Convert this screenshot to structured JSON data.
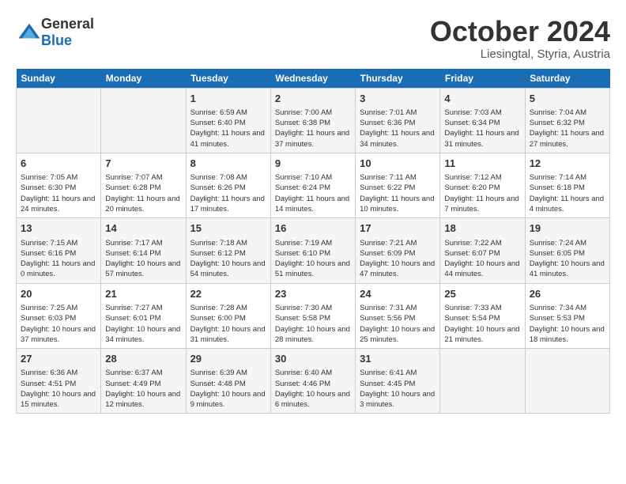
{
  "header": {
    "logo": {
      "general": "General",
      "blue": "Blue"
    },
    "title": "October 2024",
    "subtitle": "Liesingtal, Styria, Austria"
  },
  "weekdays": [
    "Sunday",
    "Monday",
    "Tuesday",
    "Wednesday",
    "Thursday",
    "Friday",
    "Saturday"
  ],
  "weeks": [
    [
      {
        "day": null,
        "info": null
      },
      {
        "day": null,
        "info": null
      },
      {
        "day": "1",
        "info": "Sunrise: 6:59 AM\nSunset: 6:40 PM\nDaylight: 11 hours and 41 minutes."
      },
      {
        "day": "2",
        "info": "Sunrise: 7:00 AM\nSunset: 6:38 PM\nDaylight: 11 hours and 37 minutes."
      },
      {
        "day": "3",
        "info": "Sunrise: 7:01 AM\nSunset: 6:36 PM\nDaylight: 11 hours and 34 minutes."
      },
      {
        "day": "4",
        "info": "Sunrise: 7:03 AM\nSunset: 6:34 PM\nDaylight: 11 hours and 31 minutes."
      },
      {
        "day": "5",
        "info": "Sunrise: 7:04 AM\nSunset: 6:32 PM\nDaylight: 11 hours and 27 minutes."
      }
    ],
    [
      {
        "day": "6",
        "info": "Sunrise: 7:05 AM\nSunset: 6:30 PM\nDaylight: 11 hours and 24 minutes."
      },
      {
        "day": "7",
        "info": "Sunrise: 7:07 AM\nSunset: 6:28 PM\nDaylight: 11 hours and 20 minutes."
      },
      {
        "day": "8",
        "info": "Sunrise: 7:08 AM\nSunset: 6:26 PM\nDaylight: 11 hours and 17 minutes."
      },
      {
        "day": "9",
        "info": "Sunrise: 7:10 AM\nSunset: 6:24 PM\nDaylight: 11 hours and 14 minutes."
      },
      {
        "day": "10",
        "info": "Sunrise: 7:11 AM\nSunset: 6:22 PM\nDaylight: 11 hours and 10 minutes."
      },
      {
        "day": "11",
        "info": "Sunrise: 7:12 AM\nSunset: 6:20 PM\nDaylight: 11 hours and 7 minutes."
      },
      {
        "day": "12",
        "info": "Sunrise: 7:14 AM\nSunset: 6:18 PM\nDaylight: 11 hours and 4 minutes."
      }
    ],
    [
      {
        "day": "13",
        "info": "Sunrise: 7:15 AM\nSunset: 6:16 PM\nDaylight: 11 hours and 0 minutes."
      },
      {
        "day": "14",
        "info": "Sunrise: 7:17 AM\nSunset: 6:14 PM\nDaylight: 10 hours and 57 minutes."
      },
      {
        "day": "15",
        "info": "Sunrise: 7:18 AM\nSunset: 6:12 PM\nDaylight: 10 hours and 54 minutes."
      },
      {
        "day": "16",
        "info": "Sunrise: 7:19 AM\nSunset: 6:10 PM\nDaylight: 10 hours and 51 minutes."
      },
      {
        "day": "17",
        "info": "Sunrise: 7:21 AM\nSunset: 6:09 PM\nDaylight: 10 hours and 47 minutes."
      },
      {
        "day": "18",
        "info": "Sunrise: 7:22 AM\nSunset: 6:07 PM\nDaylight: 10 hours and 44 minutes."
      },
      {
        "day": "19",
        "info": "Sunrise: 7:24 AM\nSunset: 6:05 PM\nDaylight: 10 hours and 41 minutes."
      }
    ],
    [
      {
        "day": "20",
        "info": "Sunrise: 7:25 AM\nSunset: 6:03 PM\nDaylight: 10 hours and 37 minutes."
      },
      {
        "day": "21",
        "info": "Sunrise: 7:27 AM\nSunset: 6:01 PM\nDaylight: 10 hours and 34 minutes."
      },
      {
        "day": "22",
        "info": "Sunrise: 7:28 AM\nSunset: 6:00 PM\nDaylight: 10 hours and 31 minutes."
      },
      {
        "day": "23",
        "info": "Sunrise: 7:30 AM\nSunset: 5:58 PM\nDaylight: 10 hours and 28 minutes."
      },
      {
        "day": "24",
        "info": "Sunrise: 7:31 AM\nSunset: 5:56 PM\nDaylight: 10 hours and 25 minutes."
      },
      {
        "day": "25",
        "info": "Sunrise: 7:33 AM\nSunset: 5:54 PM\nDaylight: 10 hours and 21 minutes."
      },
      {
        "day": "26",
        "info": "Sunrise: 7:34 AM\nSunset: 5:53 PM\nDaylight: 10 hours and 18 minutes."
      }
    ],
    [
      {
        "day": "27",
        "info": "Sunrise: 6:36 AM\nSunset: 4:51 PM\nDaylight: 10 hours and 15 minutes."
      },
      {
        "day": "28",
        "info": "Sunrise: 6:37 AM\nSunset: 4:49 PM\nDaylight: 10 hours and 12 minutes."
      },
      {
        "day": "29",
        "info": "Sunrise: 6:39 AM\nSunset: 4:48 PM\nDaylight: 10 hours and 9 minutes."
      },
      {
        "day": "30",
        "info": "Sunrise: 6:40 AM\nSunset: 4:46 PM\nDaylight: 10 hours and 6 minutes."
      },
      {
        "day": "31",
        "info": "Sunrise: 6:41 AM\nSunset: 4:45 PM\nDaylight: 10 hours and 3 minutes."
      },
      {
        "day": null,
        "info": null
      },
      {
        "day": null,
        "info": null
      }
    ]
  ]
}
